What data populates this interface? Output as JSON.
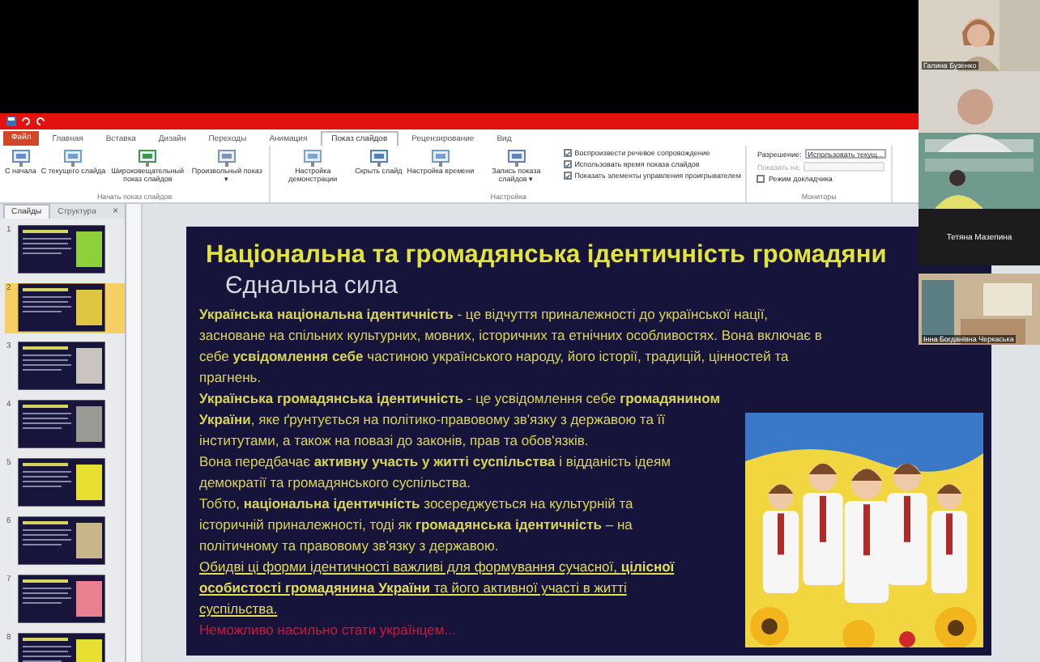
{
  "tabs": [
    {
      "label": "Файл",
      "kind": "file",
      "selected": false
    },
    {
      "label": "Главная",
      "kind": "tab",
      "selected": false
    },
    {
      "label": "Вставка",
      "kind": "tab",
      "selected": false
    },
    {
      "label": "Дизайн",
      "kind": "tab",
      "selected": false
    },
    {
      "label": "Переходы",
      "kind": "tab",
      "selected": false
    },
    {
      "label": "Анимация",
      "kind": "tab",
      "selected": false
    },
    {
      "label": "Показ слайдов",
      "kind": "tab",
      "selected": true
    },
    {
      "label": "Рецензирование",
      "kind": "tab",
      "selected": false
    },
    {
      "label": "Вид",
      "kind": "tab",
      "selected": false
    }
  ],
  "ribbon_groups": [
    {
      "label": "Начать показ слайдов",
      "items": [
        {
          "kind": "button",
          "label": "С начала"
        },
        {
          "kind": "button",
          "label": "С текущего слайда"
        },
        {
          "kind": "button",
          "label": "Широковещательный показ слайдов"
        },
        {
          "kind": "button",
          "label": "Произвольный показ ▾"
        }
      ]
    },
    {
      "label": "Настройка",
      "items": [
        {
          "kind": "button",
          "label": "Настройка демонстрации"
        },
        {
          "kind": "button",
          "label": "Скрыть слайд"
        },
        {
          "kind": "button",
          "label": "Настройка времени"
        },
        {
          "kind": "button",
          "label": "Запись показа слайдов ▾"
        },
        {
          "kind": "checkbox",
          "label": "Воспроизвести речевое сопровождение",
          "checked": true
        },
        {
          "kind": "checkbox",
          "label": "Использовать время показа слайдов",
          "checked": true
        },
        {
          "kind": "checkbox",
          "label": "Показать элементы управления проигрывателем",
          "checked": true
        }
      ]
    },
    {
      "label": "Мониторы",
      "items": [
        {
          "kind": "dropdown",
          "label": "Разрешение:",
          "value": "Использовать текущ...",
          "disabled": false
        },
        {
          "kind": "dropdown",
          "label": "Показать на:",
          "value": "",
          "disabled": true
        },
        {
          "kind": "checkbox",
          "label": "Режим докладчика",
          "checked": false
        }
      ]
    }
  ],
  "slide_pane": {
    "tabs": [
      {
        "label": "Слайды",
        "selected": true
      },
      {
        "label": "Структура",
        "selected": false
      }
    ],
    "close": "×",
    "thumbnails": [
      {
        "number": "1",
        "selected": false
      },
      {
        "number": "2",
        "selected": true
      },
      {
        "number": "3",
        "selected": false
      },
      {
        "number": "4",
        "selected": false
      },
      {
        "number": "5",
        "selected": false
      },
      {
        "number": "6",
        "selected": false
      },
      {
        "number": "7",
        "selected": false
      },
      {
        "number": "8",
        "selected": false
      }
    ]
  },
  "slide": {
    "title": "Національна та громадянська ідентичність громадяни",
    "subtitle": "Єднальна сила",
    "paragraphs": [
      {
        "kind": "normal",
        "text": "**Українська національна ідентичність** - це відчуття приналежності до української нації, засноване на спільних культурних, мовних, історичних та етнічних особливостях. Вона включає в себе **усвідомлення себе** частиною українського народу, його історії, традицій, цінностей та прагнень."
      },
      {
        "kind": "normal",
        "text": "**Українська громадянська ідентичність** - це усвідомлення себе **громадянином України**, яке ґрунтується на політико-правовому зв'язку з державою та її інститутами, а також на повазі до законів, прав та обов'язків."
      },
      {
        "kind": "normal",
        "text": "Вона передбачає **активну участь у житті суспільства** і відданість ідеям демократії та громадянського суспільства."
      },
      {
        "kind": "normal",
        "text": "Тобто, **національна ідентичність** зосереджується на культурній та історичній приналежності, тоді як **громадянська ідентичність** – на політичному та правовому зв'язку з державою."
      },
      {
        "kind": "underlined",
        "text": "Обидві ці форми ідентичності важливі для формування сучасної, **цілісної особистості громадянина України** та його активної участі в житті суспільства."
      },
      {
        "kind": "warning",
        "text": "Неможливо насильно стати українцем..."
      }
    ]
  },
  "video_tiles": [
    {
      "kind": "camera",
      "name": "Галина Бузенко"
    },
    {
      "kind": "camera_with_label",
      "name": "Тетяна Мазепина"
    },
    {
      "kind": "camera",
      "name": "Інна Богданівна Черкаська"
    }
  ]
}
